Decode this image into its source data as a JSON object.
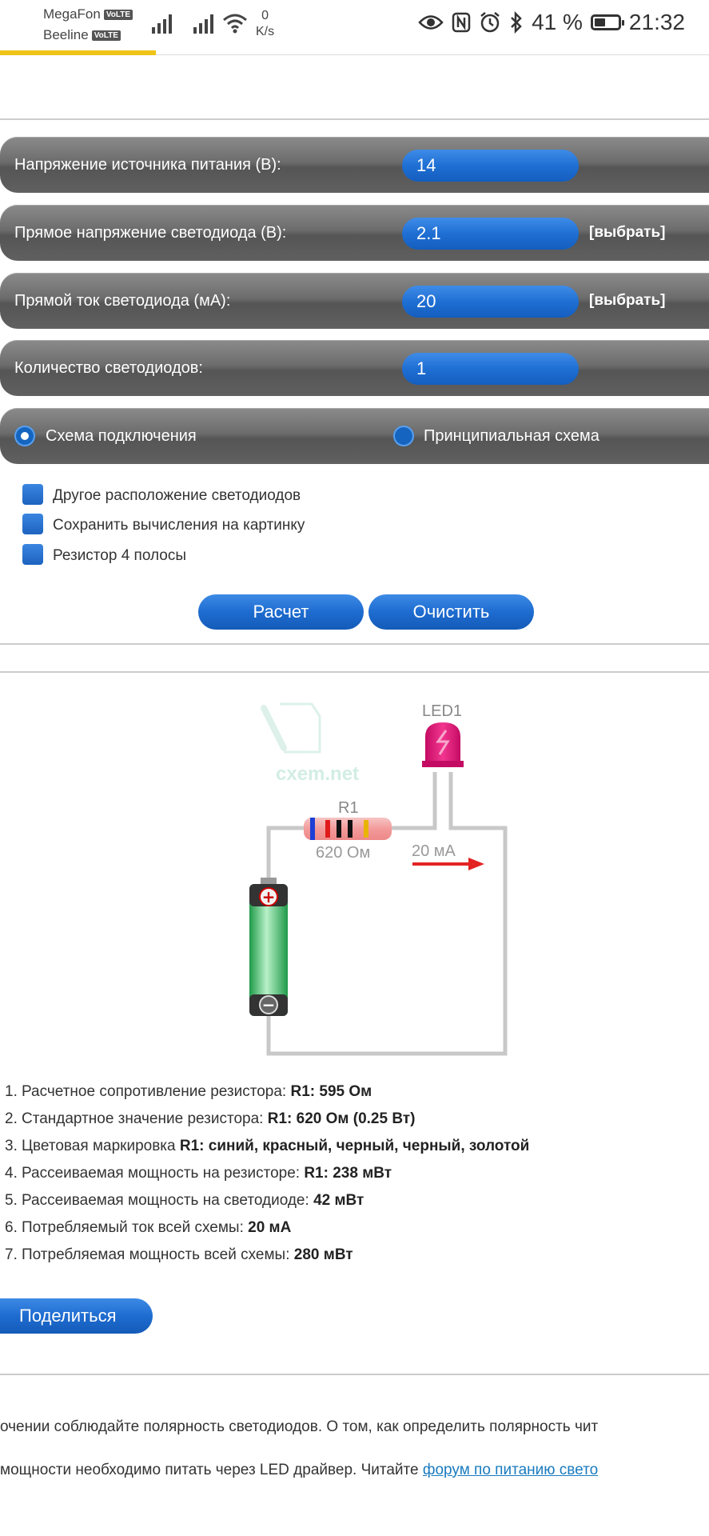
{
  "status_bar": {
    "carrier1": "MegaFon",
    "carrier2": "Beeline",
    "volte": "VoLTE",
    "net_speed_value": "0",
    "net_speed_unit": "K/s",
    "battery": "41 %",
    "time": "21:32"
  },
  "form": {
    "supply_voltage_label": "Напряжение источника питания (В):",
    "supply_voltage_value": "14",
    "forward_voltage_label": "Прямое напряжение светодиода (В):",
    "forward_voltage_value": "2.1",
    "forward_current_label": "Прямой ток светодиода (мА):",
    "forward_current_value": "20",
    "led_count_label": "Количество светодиодов:",
    "led_count_value": "1",
    "select_link": "[выбрать]",
    "radio_wiring": "Схема подключения",
    "radio_schematic": "Принципиальная схема",
    "check_other_layout": "Другое расположение светодиодов",
    "check_save_image": "Сохранить вычисления на картинку",
    "check_4band": "Резистор 4 полосы",
    "calc_button": "Расчет",
    "clear_button": "Очистить"
  },
  "diagram": {
    "led_label": "LED1",
    "resistor_label": "R1",
    "resistor_value": "620 Ом",
    "current_label": "20 мА",
    "watermark": "cxem.net",
    "plus": "+",
    "minus": "−"
  },
  "results": [
    {
      "num": "1.",
      "text": "Расчетное сопротивление резистора: ",
      "bold": "R1: 595 Ом"
    },
    {
      "num": "2.",
      "text": "Стандартное значение резистора: ",
      "bold": "R1: 620 Ом (0.25 Вт)"
    },
    {
      "num": "3.",
      "text": "Цветовая маркировка ",
      "bold": "R1: синий, красный, черный, черный, золотой"
    },
    {
      "num": "4.",
      "text": "Рассеиваемая мощность на резисторе: ",
      "bold": "R1: 238 мВт"
    },
    {
      "num": "5.",
      "text": "Рассеиваемая мощность на светодиоде: ",
      "bold": "42 мВт"
    },
    {
      "num": "6.",
      "text": "Потребляемый ток всей схемы: ",
      "bold": "20 мА"
    },
    {
      "num": "7.",
      "text": "Потребляемая мощность всей схемы: ",
      "bold": "280 мВт"
    }
  ],
  "share_button": "Поделиться",
  "footer": {
    "line1": "очении соблюдайте полярность светодиодов. О том, как определить полярность чит",
    "line2": "мощности необходимо питать через LED драйвер. Читайте ",
    "line2_link": "форум по питанию свето"
  },
  "colors": {
    "accent_blue": "#1e6cd0",
    "row_gray": "#666666",
    "status_yellow": "#f0c419",
    "led_pink": "#e8127a",
    "battery_green": "#2fbf5a",
    "arrow_red": "#e32222",
    "link_blue": "#1a7bbf"
  },
  "icons": [
    "signal-icon",
    "wifi-icon",
    "eye-icon",
    "nfc-icon",
    "alarm-icon",
    "bluetooth-icon",
    "battery-icon"
  ]
}
